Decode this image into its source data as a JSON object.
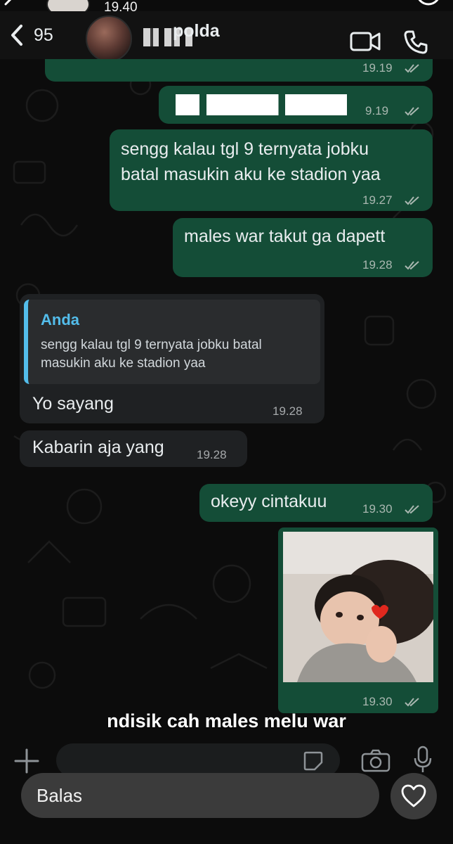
{
  "story": {
    "time": "19.40"
  },
  "header": {
    "back_count": "95",
    "contact_name": "polda"
  },
  "messages": [
    {
      "type": "outgoing",
      "text": "",
      "time": "19.19"
    },
    {
      "type": "outgoing",
      "text": "",
      "time": "9.19"
    },
    {
      "type": "outgoing",
      "text": "sengg kalau tgl 9 ternyata jobku\nbatal masukin aku ke stadion yaa",
      "time": "19.27"
    },
    {
      "type": "outgoing",
      "text": "males war takut ga dapett",
      "time": "19.28"
    },
    {
      "type": "incoming",
      "quote_author": "Anda",
      "quote_text": "sengg kalau tgl 9 ternyata jobku batal\nmasukin aku ke stadion yaa",
      "text": "Yo sayang",
      "time": "19.28"
    },
    {
      "type": "incoming",
      "text": "Kabarin aja yang",
      "time": "19.28"
    },
    {
      "type": "outgoing",
      "text": "okeyy cintakuu",
      "time": "19.30"
    },
    {
      "type": "outgoing-image",
      "time": "19.30"
    }
  ],
  "caption": "ndisik cah males melu war",
  "reply_bar": {
    "label": "Balas"
  },
  "colors": {
    "outgoing_bubble": "#144d37",
    "incoming_bubble": "#1f2123",
    "quote_accent": "#53bdeb",
    "background": "#0b0b0b"
  }
}
